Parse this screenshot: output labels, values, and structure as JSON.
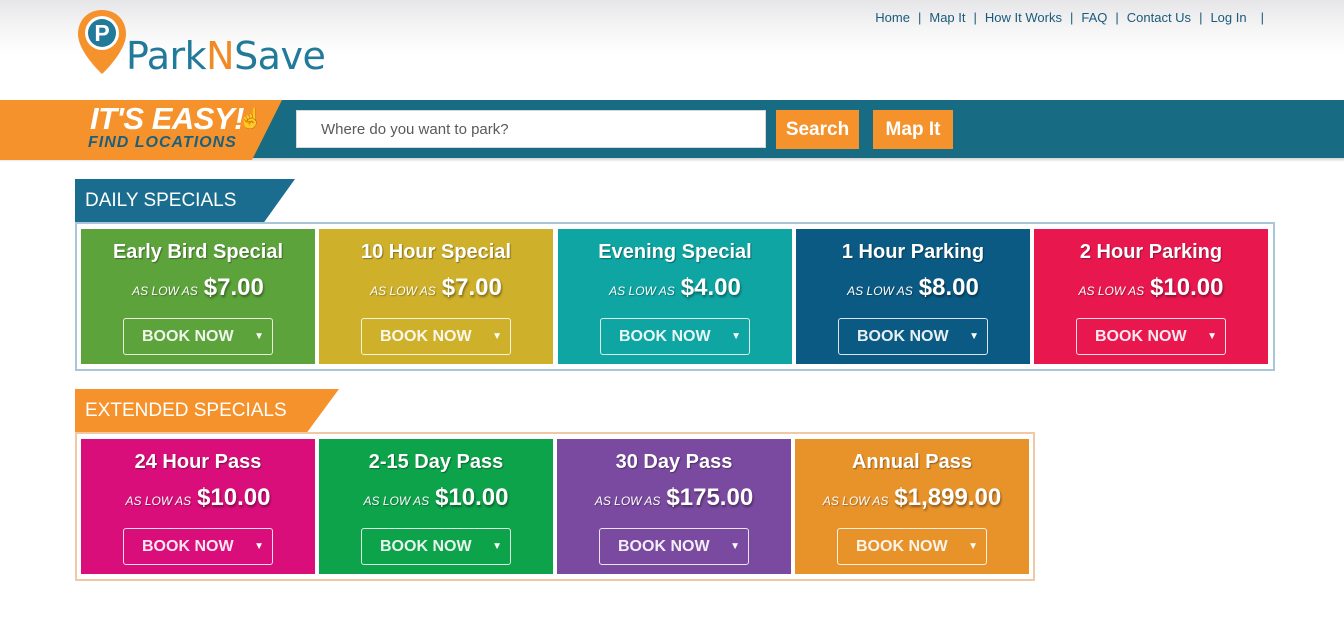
{
  "brand": {
    "logo_letter": "P",
    "name_part1": "Park",
    "name_part2": "N",
    "name_part3": "Save",
    "colors": {
      "teal": "#217a9a",
      "orange": "#f08a24"
    }
  },
  "nav": {
    "items": [
      "Home",
      "Map It",
      "How It Works",
      "FAQ",
      "Contact Us",
      "Log In"
    ],
    "separator": "|"
  },
  "search_band": {
    "headline": "IT'S EASY!",
    "subline": "FIND LOCATIONS",
    "hand_icon": "pointer-hand-icon",
    "placeholder": "Where do you want to park?",
    "value": "",
    "search_label": "Search",
    "mapit_label": "Map It"
  },
  "daily_specials": {
    "heading": "DAILY SPECIALS",
    "cards": [
      {
        "title": "Early Bird Special",
        "as_low_as": "AS LOW AS",
        "price": "$7.00",
        "button": "BOOK NOW",
        "color": "#5da33b"
      },
      {
        "title": "10 Hour Special",
        "as_low_as": "AS LOW AS",
        "price": "$7.00",
        "button": "BOOK NOW",
        "color": "#cfb02a"
      },
      {
        "title": "Evening Special",
        "as_low_as": "AS LOW AS",
        "price": "$4.00",
        "button": "BOOK NOW",
        "color": "#0ea5a3"
      },
      {
        "title": "1 Hour Parking",
        "as_low_as": "AS LOW AS",
        "price": "$8.00",
        "button": "BOOK NOW",
        "color": "#0b5a84"
      },
      {
        "title": "2 Hour Parking",
        "as_low_as": "AS LOW AS",
        "price": "$10.00",
        "button": "BOOK NOW",
        "color": "#e8184f"
      }
    ]
  },
  "extended_specials": {
    "heading": "EXTENDED SPECIALS",
    "cards": [
      {
        "title": "24 Hour Pass",
        "as_low_as": "AS LOW AS",
        "price": "$10.00",
        "button": "BOOK NOW",
        "color": "#d90e7a"
      },
      {
        "title": "2-15 Day Pass",
        "as_low_as": "AS LOW AS",
        "price": "$10.00",
        "button": "BOOK NOW",
        "color": "#0da34a"
      },
      {
        "title": "30 Day Pass",
        "as_low_as": "AS LOW AS",
        "price": "$175.00",
        "button": "BOOK NOW",
        "color": "#7a4aa0"
      },
      {
        "title": "Annual Pass",
        "as_low_as": "AS LOW AS",
        "price": "$1,899.00",
        "button": "BOOK NOW",
        "color": "#e8922a"
      }
    ]
  }
}
